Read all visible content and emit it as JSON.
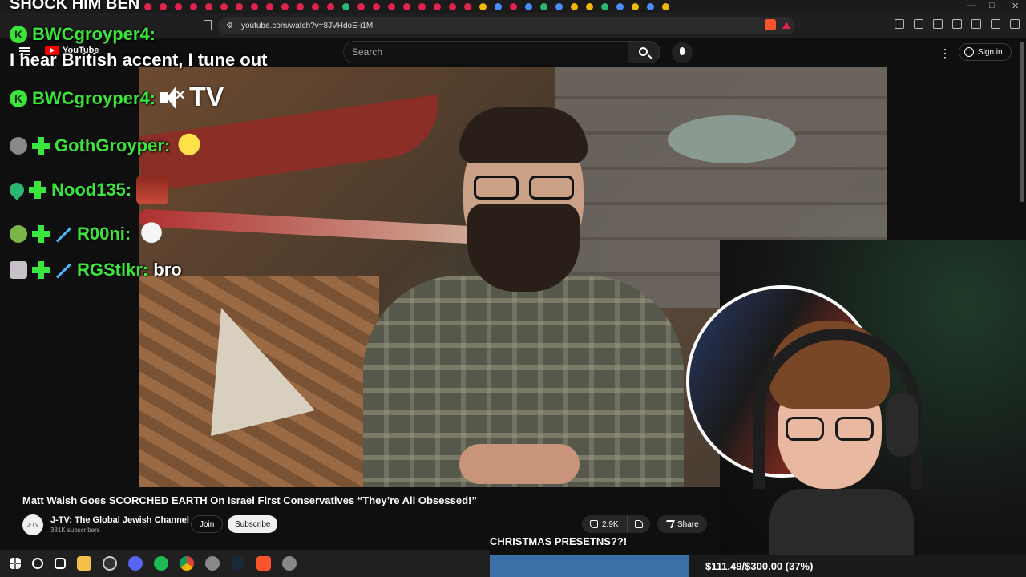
{
  "browser": {
    "url": "youtube.com/watch?v=8JVHdoE-i1M",
    "window_controls": [
      "—",
      "□",
      "✕"
    ]
  },
  "youtube": {
    "logo_text": "YouTube",
    "search_placeholder": "Search",
    "sign_in_label": "Sign in",
    "kebab_label": "⋮"
  },
  "video": {
    "mute_text": "TV",
    "title": "Matt Walsh Goes SCORCHED EARTH On Israel First Conservatives “They’re All Obsessed!”",
    "channel_avatar_text": "J-TV",
    "channel_name": "J-TV: The Global Jewish Channel",
    "subscribers": "381K subscribers",
    "join_label": "Join",
    "subscribe_label": "Subscribe",
    "like_count": "2.9K",
    "share_label": "Share"
  },
  "overlay": {
    "top_text": "SHOCK HIM BEN",
    "chat": [
      {
        "name": "BWCgroyper4:",
        "message": "",
        "badge": "k-badge"
      },
      {
        "name": "BWCgroyper4:",
        "message": "",
        "badge": "k-badge"
      },
      {
        "name": "GothGroyper:",
        "message": "",
        "badge": "avatar-badge"
      },
      {
        "name": "Nood135:",
        "message": "",
        "badge": "heart-badge"
      },
      {
        "name": "R00ni:",
        "message": "",
        "badge": "frog-badge"
      },
      {
        "name": "RGStlkr:",
        "message": "bro",
        "badge": "cross-badge"
      }
    ],
    "chat_first_message": "I hear British accent, I tune out",
    "donation_label": "CHRISTMAS PRESETNS??!",
    "goal_text": "$111.49/$300.00 (37%)",
    "goal_fraction": 0.37
  },
  "colors": {
    "chat_name": "#39e639",
    "goal_fill": "#3a6fa8",
    "yt_red": "#ff0000"
  }
}
